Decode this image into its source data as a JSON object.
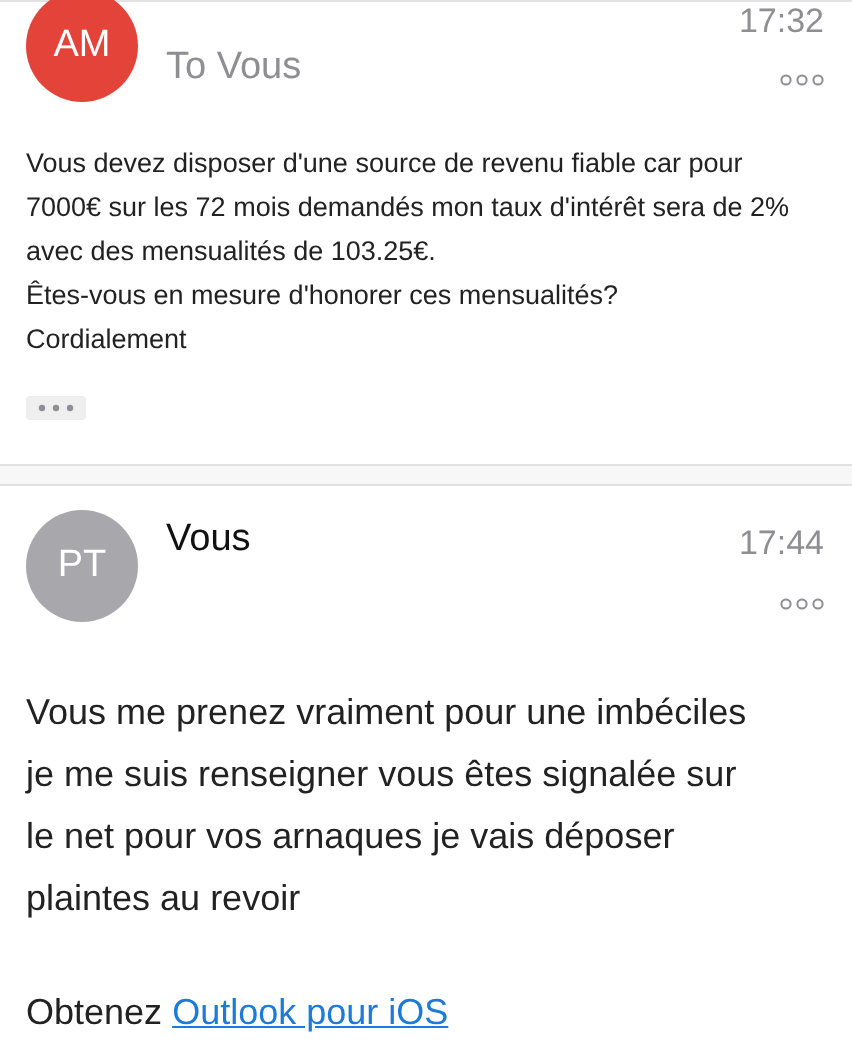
{
  "messages": [
    {
      "avatar": {
        "initials": "AM",
        "color": "#e4433a"
      },
      "sender": "To Vous",
      "kind": "received",
      "time": "17:32",
      "body": [
        "Vous devez disposer d'une source de revenu fiable car pour 7000€ sur les 72 mois demandés mon taux d'intérêt sera de 2% avec des mensualités de 103.25€.",
        "Êtes-vous en mesure d'honorer ces mensualités?",
        "Cordialement"
      ],
      "show_quoted_button": true
    },
    {
      "avatar": {
        "initials": "PT",
        "color": "#a7a7ac"
      },
      "sender": "Vous",
      "kind": "sent",
      "time": "17:44",
      "body": [
        "Vous me prenez vraiment pour une imbéciles je me suis renseigner vous êtes signalée sur le net pour vos arnaques je vais déposer plaintes au revoir"
      ],
      "show_quoted_button": false,
      "signature": {
        "text": "Obtenez",
        "link": "Outlook pour iOS"
      }
    }
  ]
}
